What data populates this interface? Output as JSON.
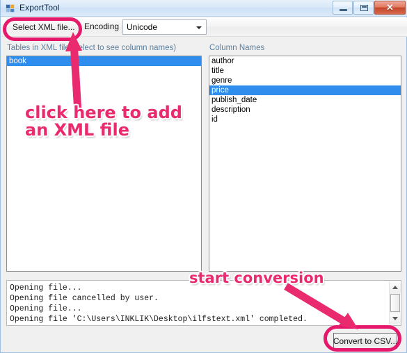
{
  "window": {
    "title": "ExportTool",
    "icon": "app-icon",
    "buttons": {
      "minimize": "minimize",
      "maximize": "maximize",
      "close": "✕"
    }
  },
  "toolbar": {
    "select_file_label": "Select XML file...",
    "encoding_label": "Encoding",
    "encoding_value": "Unicode",
    "encoding_options": [
      "Unicode"
    ]
  },
  "tables_panel": {
    "label": "Tables in XML file (select to see column names)",
    "items": [
      {
        "name": "book",
        "selected": true
      }
    ]
  },
  "columns_panel": {
    "label": "Column Names",
    "items": [
      {
        "name": "author",
        "selected": false
      },
      {
        "name": "title",
        "selected": false
      },
      {
        "name": "genre",
        "selected": false
      },
      {
        "name": "price",
        "selected": true
      },
      {
        "name": "publish_date",
        "selected": false
      },
      {
        "name": "description",
        "selected": false
      },
      {
        "name": "id",
        "selected": false
      }
    ]
  },
  "log": {
    "lines": [
      "Opening file...",
      "Opening file cancelled by user.",
      "Opening file...",
      "Opening file 'C:\\Users\\INKLIK\\Desktop\\ilfstext.xml' completed."
    ]
  },
  "footer": {
    "convert_label": "Convert to CSV..."
  },
  "annotations": {
    "color": "#ea2a6e",
    "items": [
      {
        "id": "add-file",
        "text": "click here to add\nan XML file"
      },
      {
        "id": "start-conversion",
        "text": "start conversion"
      }
    ]
  }
}
